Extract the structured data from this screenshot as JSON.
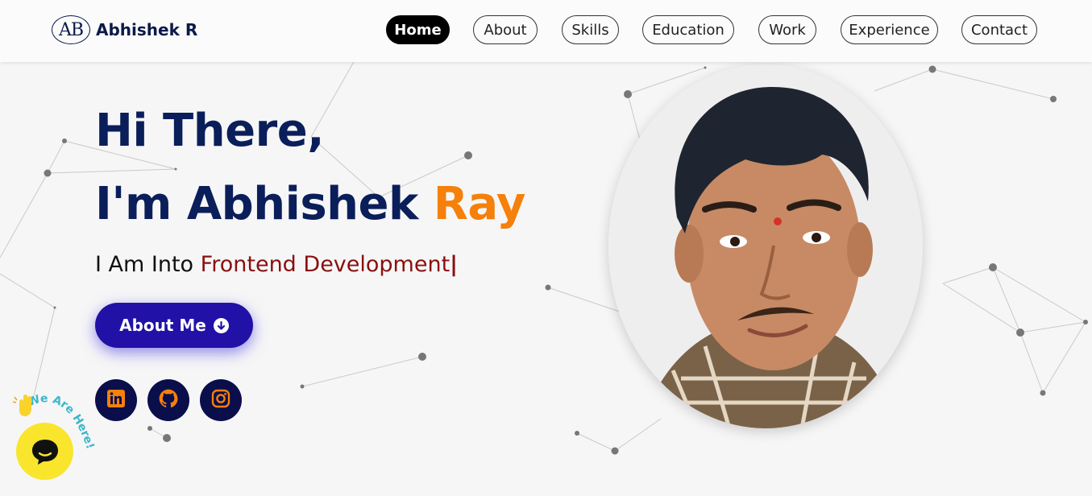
{
  "brand": {
    "logo_mark": "AB",
    "name": "Abhishek R"
  },
  "nav": {
    "items": [
      {
        "label": "Home",
        "active": true
      },
      {
        "label": "About",
        "active": false
      },
      {
        "label": "Skills",
        "active": false
      },
      {
        "label": "Education",
        "active": false
      },
      {
        "label": "Work",
        "active": false
      },
      {
        "label": "Experience",
        "active": false
      },
      {
        "label": "Contact",
        "active": false
      }
    ]
  },
  "hero": {
    "greeting": "Hi There,",
    "intro_prefix": "I'm Abhishek ",
    "intro_highlight": "Ray",
    "role_prefix": "I Am Into ",
    "role": "Frontend Development",
    "caret": "|",
    "cta_label": "About Me",
    "cta_icon": "arrow-down-circle-icon"
  },
  "socials": [
    {
      "name": "linkedin-icon"
    },
    {
      "name": "github-icon"
    },
    {
      "name": "instagram-icon"
    }
  ],
  "chat_widget": {
    "badge_text": "We Are Here!",
    "icon": "chat-bubble-icon"
  },
  "colors": {
    "navy": "#0a1e5a",
    "accent_orange": "#f5800a",
    "role_red": "#8a0f0f",
    "button_blue": "#2211a6",
    "social_bg": "#0a0e4a",
    "social_icon": "#f5800a",
    "chat_yellow": "#f9e52c"
  }
}
